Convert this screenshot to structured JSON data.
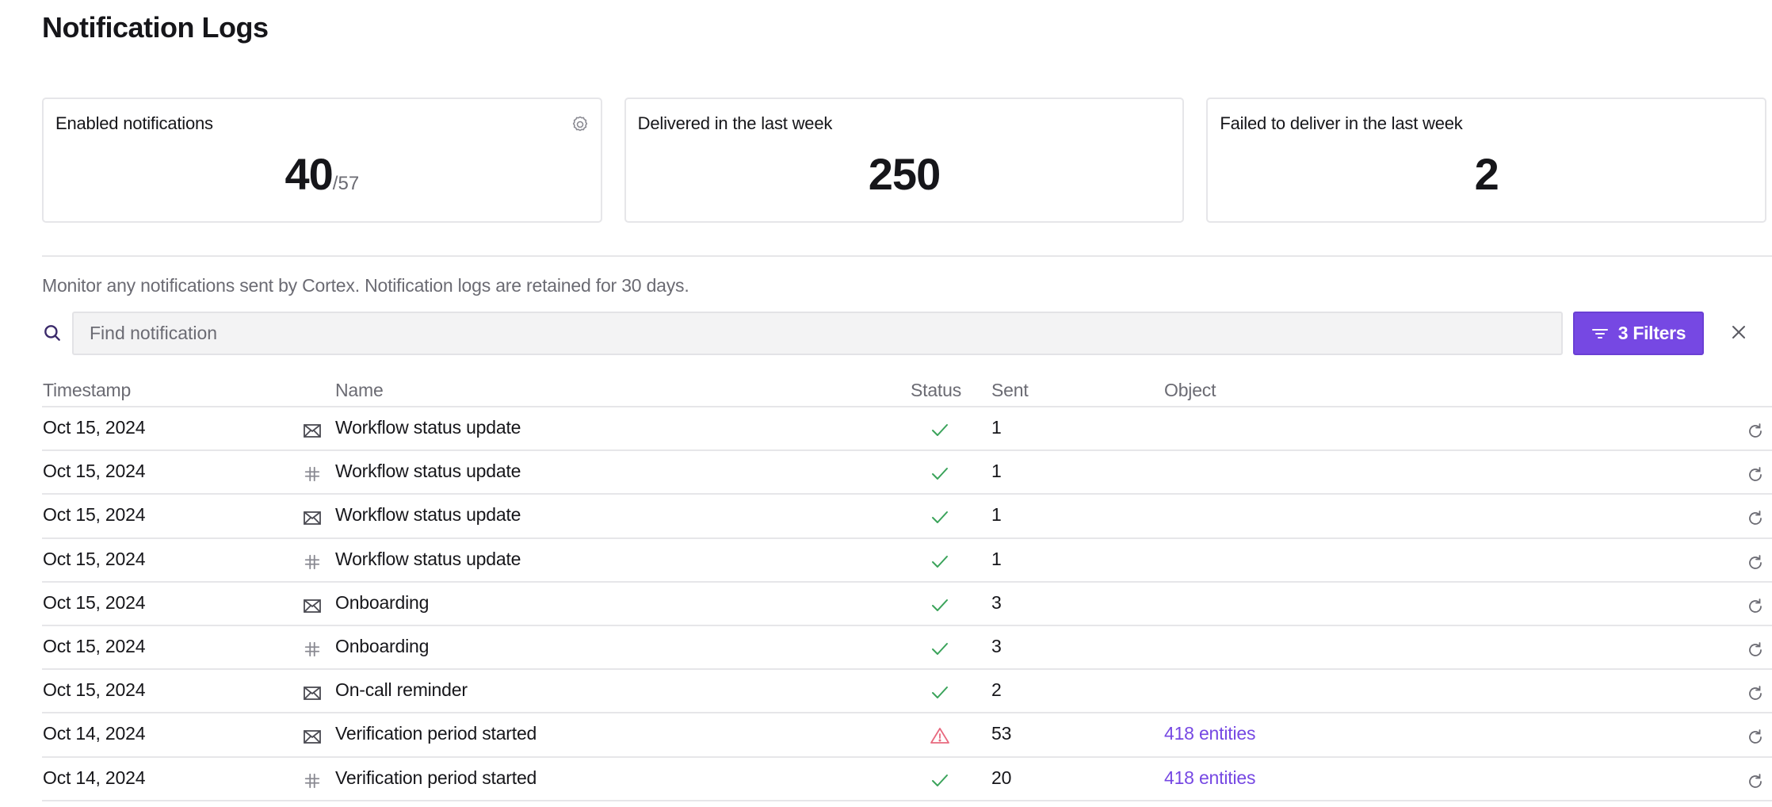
{
  "page": {
    "title": "Notification Logs",
    "description": "Monitor any notifications sent by Cortex. Notification logs are retained for 30 days."
  },
  "cards": [
    {
      "label": "Enabled notifications",
      "value": "40",
      "denominator": "/57",
      "icon": "gear-icon"
    },
    {
      "label": "Delivered in the last week",
      "value": "250"
    },
    {
      "label": "Failed to deliver in the last week",
      "value": "2"
    }
  ],
  "search": {
    "placeholder": "Find notification",
    "value": "",
    "icon": "search-icon"
  },
  "filters": {
    "label": "3 Filters",
    "icon": "filter-icon",
    "clear_icon": "close-icon"
  },
  "colors": {
    "accent": "#7648e3",
    "success": "#3aa35a",
    "error": "#e8697f",
    "muted_text": "#6b6b73"
  },
  "table": {
    "columns": [
      "Timestamp",
      "Name",
      "Status",
      "Sent",
      "Object"
    ],
    "rows": [
      {
        "timestamp": "Oct 15, 2024",
        "channel": "email",
        "name": "Workflow status update",
        "status": "success",
        "sent": "1",
        "object": ""
      },
      {
        "timestamp": "Oct 15, 2024",
        "channel": "slack",
        "name": "Workflow status update",
        "status": "success",
        "sent": "1",
        "object": ""
      },
      {
        "timestamp": "Oct 15, 2024",
        "channel": "email",
        "name": "Workflow status update",
        "status": "success",
        "sent": "1",
        "object": ""
      },
      {
        "timestamp": "Oct 15, 2024",
        "channel": "slack",
        "name": "Workflow status update",
        "status": "success",
        "sent": "1",
        "object": ""
      },
      {
        "timestamp": "Oct 15, 2024",
        "channel": "email",
        "name": "Onboarding",
        "status": "success",
        "sent": "3",
        "object": ""
      },
      {
        "timestamp": "Oct 15, 2024",
        "channel": "slack",
        "name": "Onboarding",
        "status": "success",
        "sent": "3",
        "object": ""
      },
      {
        "timestamp": "Oct 15, 2024",
        "channel": "email",
        "name": "On-call reminder",
        "status": "success",
        "sent": "2",
        "object": ""
      },
      {
        "timestamp": "Oct 14, 2024",
        "channel": "email",
        "name": "Verification period started",
        "status": "warning",
        "sent": "53",
        "object": "418 entities"
      },
      {
        "timestamp": "Oct 14, 2024",
        "channel": "slack",
        "name": "Verification period started",
        "status": "success",
        "sent": "20",
        "object": "418 entities"
      }
    ]
  }
}
